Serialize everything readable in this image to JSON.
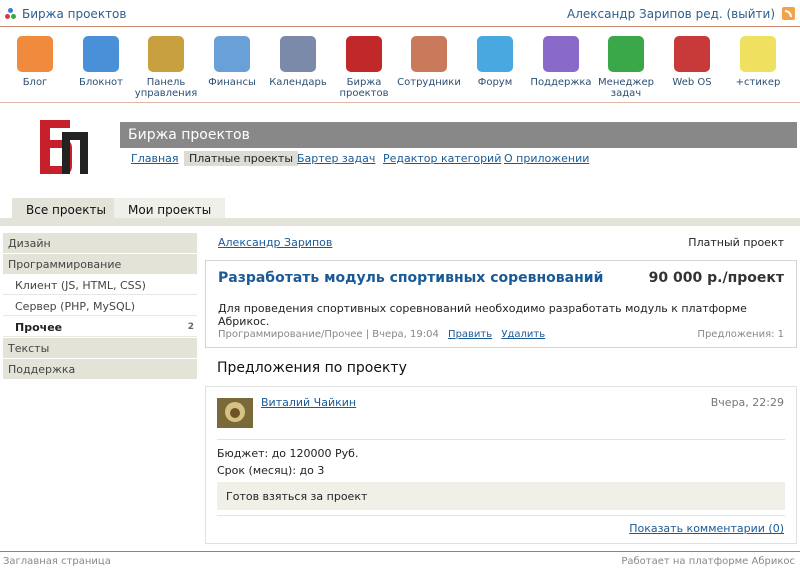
{
  "topbar": {
    "site_title": "Биржа проектов",
    "user_info": "Александр Зарипов ред. (выйти)"
  },
  "apps": [
    {
      "label": "Блог",
      "icon": "blogger-icon",
      "color": "#f08a3c"
    },
    {
      "label": "Блокнот",
      "icon": "notepad-icon",
      "color": "#4a90d9"
    },
    {
      "label": "Панель управления",
      "icon": "tools-icon",
      "color": "#c9a040"
    },
    {
      "label": "Финансы",
      "icon": "chart-icon",
      "color": "#6aa0d8"
    },
    {
      "label": "Календарь",
      "icon": "calendar-icon",
      "color": "#7a8aa8"
    },
    {
      "label": "Биржа проектов",
      "icon": "bp-logo-icon",
      "color": "#c0282a"
    },
    {
      "label": "Сотрудники",
      "icon": "people-icon",
      "color": "#c87a5a"
    },
    {
      "label": "Форум",
      "icon": "forum-icon",
      "color": "#4aa8e0"
    },
    {
      "label": "Поддержка",
      "icon": "help-icon",
      "color": "#8a6ac8"
    },
    {
      "label": "Менеджер задач",
      "icon": "checklist-icon",
      "color": "#3aa848"
    },
    {
      "label": "Web OS",
      "icon": "molecule-icon",
      "color": "#c83a3a"
    },
    {
      "label": "+стикер",
      "icon": "sticker-icon",
      "color": "#f0e060"
    }
  ],
  "module": {
    "title": "Биржа проектов",
    "nav": [
      "Главная",
      "Платные проекты",
      "Бартер задач",
      "Редактор категорий",
      "О приложении"
    ]
  },
  "tabs": [
    "Все проекты",
    "Мои проекты"
  ],
  "sidebar": {
    "items": [
      {
        "label": "Дизайн",
        "kind": "group"
      },
      {
        "label": "Программирование",
        "kind": "group"
      },
      {
        "label": "Клиент (JS, HTML, CSS)",
        "kind": "sub"
      },
      {
        "label": "Сервер (PHP, MySQL)",
        "kind": "sub"
      },
      {
        "label": "Прочее",
        "kind": "sub-active",
        "count": "2"
      },
      {
        "label": "Тексты",
        "kind": "group"
      },
      {
        "label": "Поддержка",
        "kind": "group"
      }
    ]
  },
  "project": {
    "author": "Александр Зарипов",
    "type": "Платный проект",
    "title": "Разработать модуль спортивных соревнований",
    "price": "90 000 р./проект",
    "description": "Для проведения спортивных соревнований необходимо разработать модуль к платформе Абрикос.",
    "meta": "Программирование/Прочее | Вчера, 19:04",
    "edit_label": "Править",
    "delete_label": "Удалить",
    "offers_count": "Предложения: 1"
  },
  "offers": {
    "heading": "Предложения по проекту",
    "items": [
      {
        "user": "Виталий Чайкин",
        "date": "Вчера, 22:29",
        "budget": "Бюджет:  до 120000  Руб.",
        "term": "Срок (месяц):  до 3",
        "message": "Готов взяться за проект",
        "comments_link": "Показать комментарии (0)"
      }
    ]
  },
  "footer": {
    "left": "Заглавная страница",
    "right": "Работает на платформе Абрикос"
  }
}
